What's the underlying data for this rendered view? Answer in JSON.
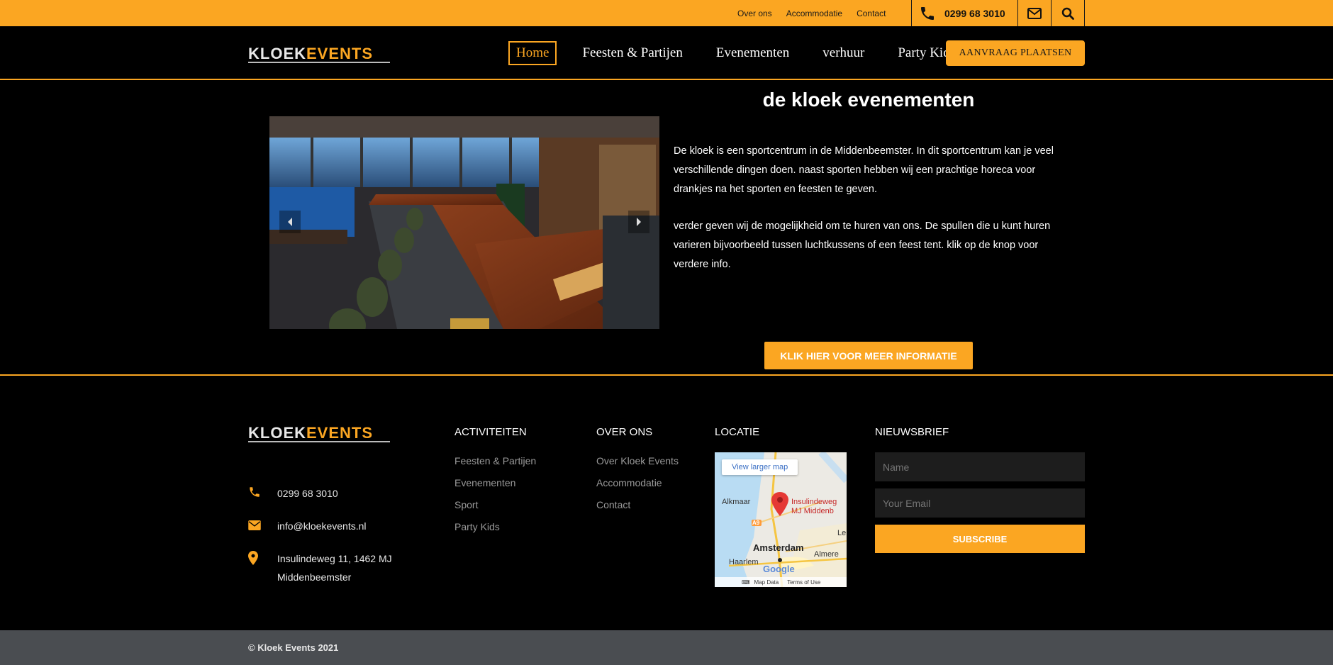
{
  "topbar": {
    "links": [
      "Over ons",
      "Accommodatie",
      "Contact"
    ],
    "phone": "0299 68 3010",
    "mail_icon": "envelope-icon",
    "search_icon": "search-icon"
  },
  "brand": {
    "logo_left": "KLOEK",
    "logo_right": "EVENTS"
  },
  "nav": {
    "items": [
      "Home",
      "Feesten & Partijen",
      "Evenementen",
      "verhuur",
      "Party Kids"
    ],
    "cta": "AANVRAAG PLAATSEN"
  },
  "main": {
    "title": "de kloek evenementen",
    "paragraph1": "De kloek is een sportcentrum in de Middenbeemster. In dit sportcentrum kan je veel verschillende dingen doen. naast sporten hebben wij een prachtige horeca voor drankjes na het sporten en feesten te geven.",
    "paragraph2": "verder geven wij de mogelijkheid om te huren van ons. De spullen die u kunt huren varieren bijvoorbeeld tussen luchtkussens of een feest tent. klik op de knop voor verdere info.",
    "button": "KLIK HIER VOOR MEER INFORMATIE"
  },
  "footer": {
    "contact": {
      "phone": "0299 68 3010",
      "email": "info@kloekevents.nl",
      "address_line1": "Insulindeweg 11, 1462 MJ",
      "address_line2": "Middenbeemster"
    },
    "activiteiten": {
      "heading": "ACTIVITEITEN",
      "links": [
        "Feesten & Partijen",
        "Evenementen",
        "Sport",
        "Party Kids"
      ]
    },
    "over_ons": {
      "heading": "OVER ONS",
      "links": [
        "Over Kloek Events",
        "Accommodatie",
        "Contact"
      ]
    },
    "locatie": {
      "heading": "LOCATIE",
      "map_button": "View larger map",
      "labels": [
        "Alkmaar",
        "Insulindeweg",
        "MJ Middenb",
        "Amsterdam",
        "Haarlem",
        "Almere",
        "Le",
        "A9",
        "Google"
      ],
      "bottom": [
        "Map Data",
        "Terms of Use"
      ]
    },
    "nieuwsbrief": {
      "heading": "NIEUWSBRIEF",
      "name_placeholder": "Name",
      "email_placeholder": "Your Email",
      "button": "SUBSCRIBE"
    }
  },
  "copyright": "© Kloek Events 2021",
  "colors": {
    "accent": "#fba622",
    "background": "#000000",
    "bottom_bar": "#4a4d51"
  }
}
